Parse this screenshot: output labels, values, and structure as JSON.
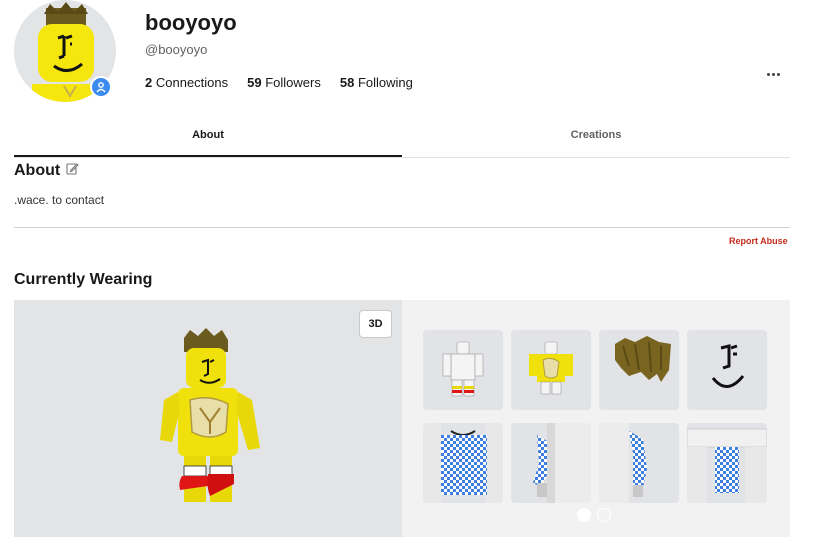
{
  "profile": {
    "username": "booyoyo",
    "handle": "@booyoyo",
    "stats": {
      "connections_count": "2",
      "connections_label": "Connections",
      "followers_count": "59",
      "followers_label": "Followers",
      "following_count": "58",
      "following_label": "Following"
    }
  },
  "tabs": [
    {
      "label": "About"
    },
    {
      "label": "Creations"
    }
  ],
  "about": {
    "title": "About",
    "text": ".wace. to contact",
    "report_label": "Report Abuse"
  },
  "wearing": {
    "title": "Currently Wearing",
    "view_toggle_label": "3D",
    "items": [
      {
        "name": "shirt-item"
      },
      {
        "name": "yellow-shirt-item"
      },
      {
        "name": "hair-item"
      },
      {
        "name": "face-item"
      },
      {
        "name": "checkered-shirt-item"
      },
      {
        "name": "checkered-arms-item"
      },
      {
        "name": "checkered-sleeves-item"
      },
      {
        "name": "checkered-pants-item"
      }
    ],
    "pages": 2,
    "active_page": 1
  },
  "colors": {
    "verified": "#3c8cf0",
    "report": "#c32b1b",
    "avatar_yellow": "#f5e60e",
    "checker_blue": "#3c7fe0"
  }
}
